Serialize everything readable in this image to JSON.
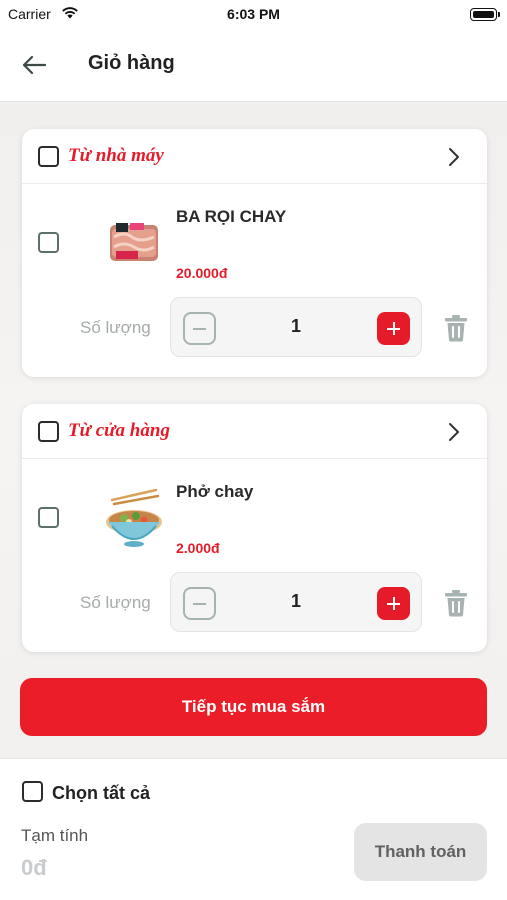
{
  "status_bar": {
    "carrier": "Carrier",
    "time": "6:03 PM"
  },
  "header": {
    "title": "Giỏ hàng"
  },
  "cart_groups": [
    {
      "title": "Từ nhà máy",
      "product": {
        "name": "BA RỌI CHAY",
        "price": "20.000đ",
        "quantity_label": "Số lượng",
        "quantity": "1"
      }
    },
    {
      "title": "Từ cửa hàng",
      "product": {
        "name": "Phở chay",
        "price": "2.000đ",
        "quantity_label": "Số lượng",
        "quantity": "1"
      }
    }
  ],
  "continue_shopping_label": "Tiếp tục mua sắm",
  "footer": {
    "select_all_label": "Chọn tất cả",
    "subtotal_label": "Tạm tính",
    "subtotal_value": "0đ",
    "checkout_label": "Thanh toán"
  },
  "colors": {
    "accent": "#e51b2a",
    "muted_text": "#a5aba9",
    "disabled_button": "#e4e4e4"
  },
  "icons": {
    "back": "arrow-left-icon",
    "chevron": "chevron-right-icon",
    "minus": "minus-icon",
    "plus": "plus-icon",
    "trash": "trash-icon",
    "wifi": "wifi-icon",
    "battery": "battery-icon"
  }
}
